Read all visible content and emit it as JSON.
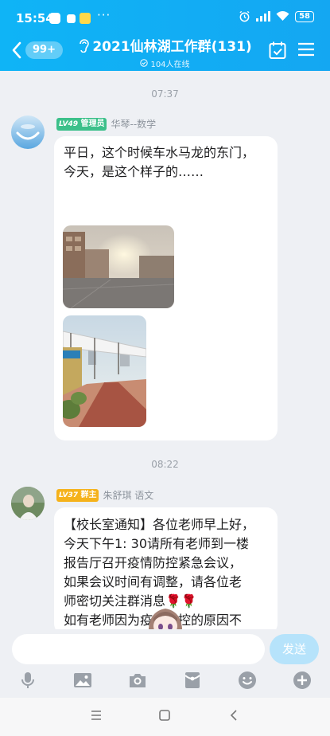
{
  "status_bar": {
    "time": "15:54",
    "more": "···",
    "battery": "58"
  },
  "header": {
    "unread_badge": "99+",
    "title": "2021仙林湖工作群(131)",
    "online": "104人在线",
    "accent_color": "#12adf4"
  },
  "messages": [
    {
      "time": "07:37",
      "level": "LV49",
      "role": "管理员",
      "role_color": "#3cc08a",
      "sender": "华琴--数学",
      "text_lines": [
        "平日，这个时候车水马龙的东门，",
        "今天，是这个样子的……"
      ]
    },
    {
      "time": "08:22",
      "level": "LV37",
      "role": "群主",
      "role_color": "#f5b21b",
      "sender": "朱舒琪 语文",
      "text_lines": [
        "【校长室通知】各位老师早上好，",
        "今天下午1: 30请所有老师到一楼",
        "报告厅召开疫情防控紧急会议，",
        "如果会议时间有调整，请各位老",
        "师密切关注群消息🌹🌹",
        "如有老师因为疫情防控的原因不"
      ]
    }
  ],
  "composer": {
    "placeholder": "",
    "send_label": "发送"
  },
  "toolbar": [
    "mic-icon",
    "image-icon",
    "camera-icon",
    "red-packet-icon",
    "emoji-icon",
    "plus-icon"
  ]
}
